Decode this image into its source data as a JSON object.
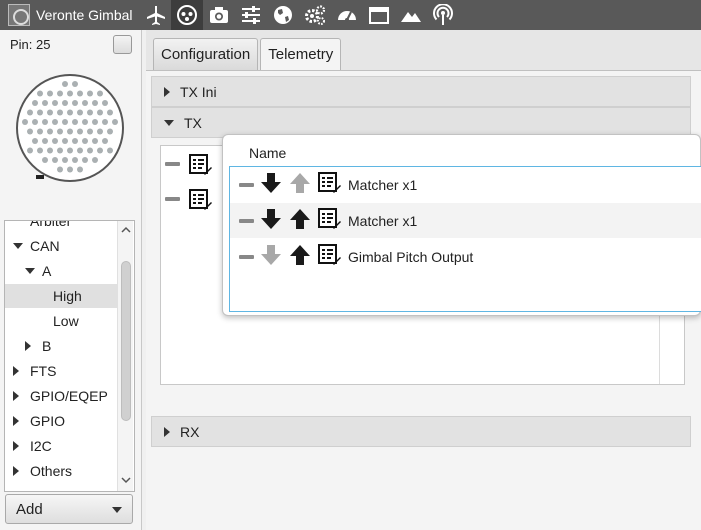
{
  "app": {
    "title": "Veronte Gimbal"
  },
  "toolbar": {
    "icons": [
      "airplane-icon",
      "joystick-icon",
      "camera-icon",
      "sliders-icon",
      "globe-icon",
      "gears-icon",
      "gauge-icon",
      "window-icon",
      "mountain-icon",
      "broadcast-icon"
    ],
    "active_index": 1
  },
  "left_panel": {
    "pin_label": "Pin: 25",
    "tree": [
      {
        "label": "Arbiter",
        "indent": 0,
        "arrow": "none",
        "selected": false
      },
      {
        "label": "CAN",
        "indent": 0,
        "arrow": "down",
        "selected": false
      },
      {
        "label": "A",
        "indent": 1,
        "arrow": "down",
        "selected": false
      },
      {
        "label": "High",
        "indent": 2,
        "arrow": "none",
        "selected": true
      },
      {
        "label": "Low",
        "indent": 2,
        "arrow": "none",
        "selected": false
      },
      {
        "label": "B",
        "indent": 1,
        "arrow": "right",
        "selected": false
      },
      {
        "label": "FTS",
        "indent": 0,
        "arrow": "right",
        "selected": false
      },
      {
        "label": "GPIO/EQEP",
        "indent": 0,
        "arrow": "right",
        "selected": false
      },
      {
        "label": "GPIO",
        "indent": 0,
        "arrow": "right",
        "selected": false
      },
      {
        "label": "I2C",
        "indent": 0,
        "arrow": "right",
        "selected": false
      },
      {
        "label": "Others",
        "indent": 0,
        "arrow": "right",
        "selected": false
      }
    ],
    "add_button": "Add"
  },
  "tabs": [
    {
      "label": "Configuration",
      "active": false
    },
    {
      "label": "Telemetry",
      "active": true
    }
  ],
  "sections": {
    "tx_ini": "TX Ini",
    "tx": "TX",
    "rx": "RX"
  },
  "popup": {
    "column_header": "Name",
    "rows": [
      {
        "name": "Matcher x1",
        "down_enabled": true,
        "up_enabled": false
      },
      {
        "name": "Matcher x1",
        "down_enabled": true,
        "up_enabled": true
      },
      {
        "name": "Gimbal Pitch Output",
        "down_enabled": false,
        "up_enabled": true
      }
    ]
  },
  "colors": {
    "toolbar_bg": "#595959",
    "selection_border": "#5fb6e3",
    "arrow_enabled": "#1a1a1a",
    "arrow_disabled": "#a8a8a8"
  }
}
